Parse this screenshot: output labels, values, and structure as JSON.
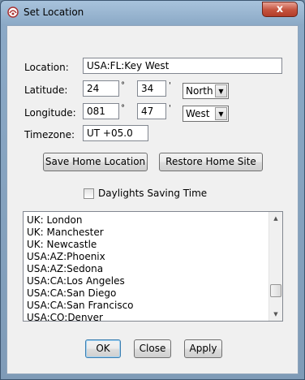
{
  "window": {
    "title": "Set Location",
    "close_glyph": "x",
    "app_icon": "app-icon"
  },
  "form": {
    "location_label": "Location:",
    "location_value": "USA:FL:Key West",
    "latitude_label": "Latitude:",
    "lat_deg": "24",
    "lat_min": "34",
    "lat_dir": "North",
    "longitude_label": "Longitude:",
    "lon_deg": "081",
    "lon_min": "47",
    "lon_dir": "West",
    "timezone_label": "Timezone:",
    "timezone_value": "UT +05.0",
    "deg_symbol": "°",
    "min_symbol": "'"
  },
  "buttons": {
    "save_home": "Save Home Location",
    "restore_home": "Restore Home Site",
    "ok": "OK",
    "close": "Close",
    "apply": "Apply"
  },
  "daylight": {
    "label": "Daylights Saving Time",
    "checked": false
  },
  "locations": [
    "UK: London",
    "UK: Manchester",
    "UK: Newcastle",
    "USA:AZ:Phoenix",
    "USA:AZ:Sedona",
    "USA:CA:Los Angeles",
    "USA:CA:San Diego",
    "USA:CA:San Francisco",
    "USA:CO:Denver"
  ],
  "list_scroll_position": 0.85
}
